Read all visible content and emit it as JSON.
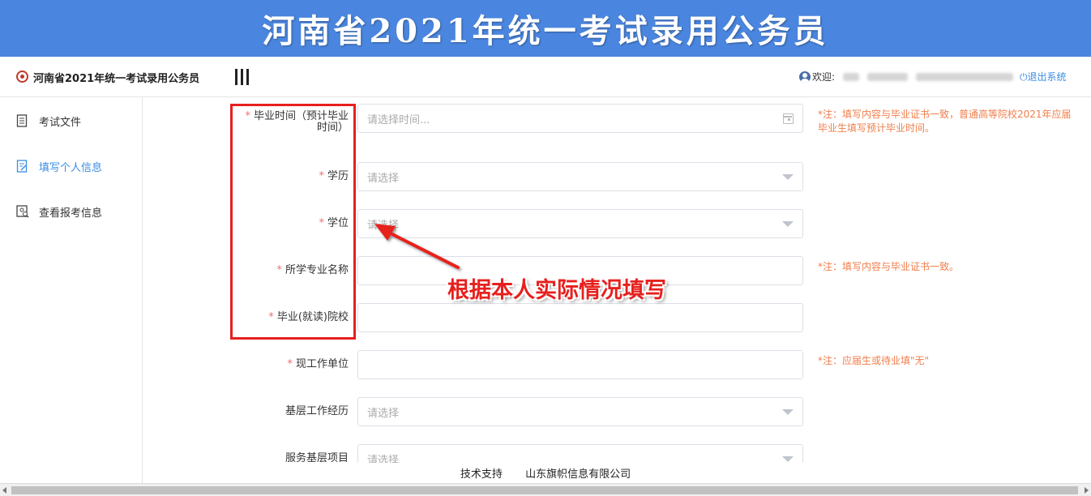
{
  "banner": {
    "title": "河南省2021年统一考试录用公务员"
  },
  "header": {
    "site_name": "河南省2021年统一考试录用公务员",
    "welcome_label": "欢迎:",
    "logout_label": "⏻退出系统",
    "menu_toggle_icon": "menu-bars-icon",
    "user_icon": "user-circle-icon"
  },
  "sidebar": {
    "items": [
      {
        "label": "考试文件",
        "icon": "document-icon",
        "active": false
      },
      {
        "label": "填写个人信息",
        "icon": "edit-form-icon",
        "active": true
      },
      {
        "label": "查看报考信息",
        "icon": "search-profile-icon",
        "active": false
      }
    ]
  },
  "form": {
    "fields": [
      {
        "label": "毕业时间（预计毕业",
        "label2": "时间）",
        "required": true,
        "type": "date",
        "placeholder": "请选择时间...",
        "note": "*注：填写内容与毕业证书一致，普通高等院校2021年应届",
        "note2": "毕业生填写预计毕业时间。"
      },
      {
        "label": "学历",
        "required": true,
        "type": "select",
        "placeholder": "请选择",
        "note": ""
      },
      {
        "label": "学位",
        "required": true,
        "type": "select",
        "placeholder": "请选择",
        "note": ""
      },
      {
        "label": "所学专业名称",
        "required": true,
        "type": "text",
        "placeholder": "",
        "note": "*注：填写内容与毕业证书一致。"
      },
      {
        "label": "毕业(就读)院校",
        "required": true,
        "type": "text",
        "placeholder": "",
        "note": ""
      },
      {
        "label": "现工作单位",
        "required": true,
        "type": "text",
        "placeholder": "",
        "note": "*注：应届生或待业填\"无\""
      },
      {
        "label": "基层工作经历",
        "required": false,
        "type": "select",
        "placeholder": "请选择",
        "note": ""
      },
      {
        "label": "服务基层项目",
        "required": false,
        "type": "select",
        "placeholder": "请选择",
        "note": ""
      }
    ],
    "required_mark": "*"
  },
  "annotation": {
    "callout": "根据本人实际情况填写",
    "color": "#e6201e"
  },
  "footer": {
    "support_label": "技术支持",
    "company": "山东旗帜信息有限公司"
  },
  "colors": {
    "banner": "#4a86e0",
    "accent": "#3a8ee6",
    "note": "#f07e4b",
    "required": "#f56c6c"
  }
}
